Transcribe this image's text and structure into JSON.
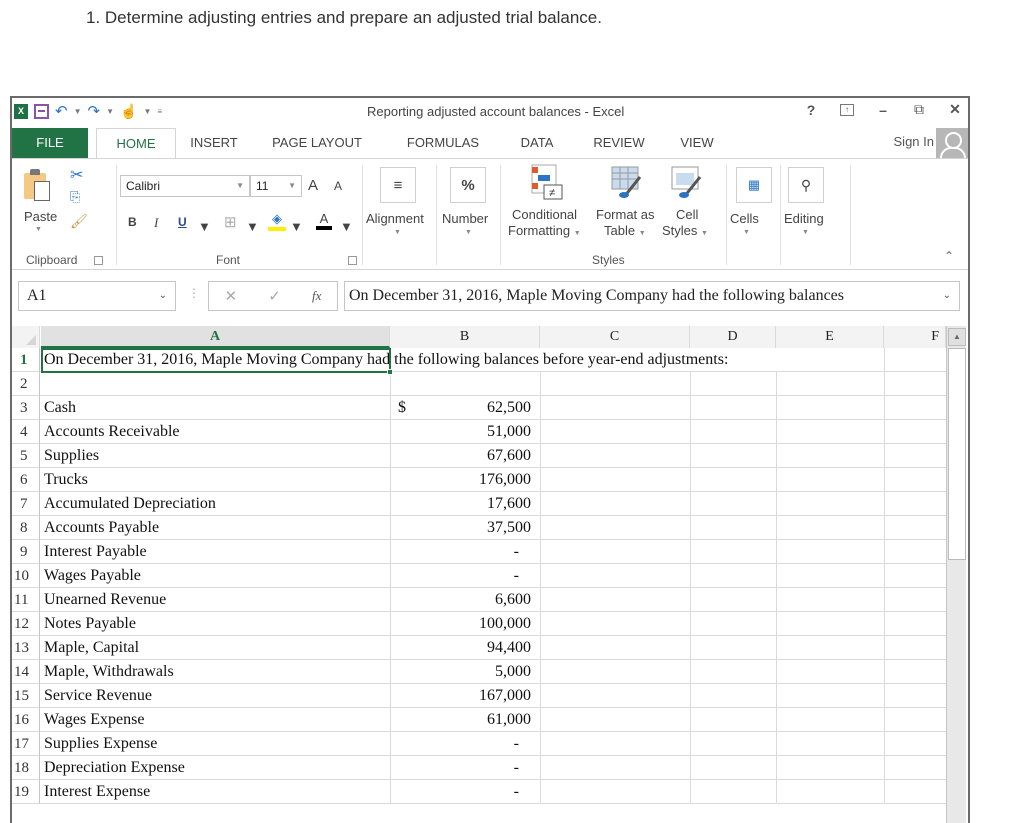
{
  "question": "1.  Determine adjusting entries and prepare an adjusted trial balance.",
  "window": {
    "title": "Reporting adjusted account balances - Excel",
    "controls": {
      "help": "?",
      "minimize": "–",
      "restore": "🗗",
      "close": "✕"
    }
  },
  "tabs": [
    {
      "label": "FILE"
    },
    {
      "label": "HOME"
    },
    {
      "label": "INSERT"
    },
    {
      "label": "PAGE LAYOUT"
    },
    {
      "label": "FORMULAS"
    },
    {
      "label": "DATA"
    },
    {
      "label": "REVIEW"
    },
    {
      "label": "VIEW"
    }
  ],
  "sign_in": "Sign In",
  "ribbon": {
    "clipboard": {
      "label": "Clipboard",
      "paste": "Paste"
    },
    "font": {
      "label": "Font",
      "name": "Calibri",
      "size": "11",
      "bold": "B",
      "italic": "I",
      "underline": "U",
      "grow": "A",
      "shrink": "A",
      "color": "A"
    },
    "alignment": "Alignment",
    "number": "Number",
    "styles": {
      "label": "Styles",
      "conditional_1": "Conditional",
      "conditional_2": "Formatting",
      "format_table_1": "Format as",
      "format_table_2": "Table",
      "cell_styles_1": "Cell",
      "cell_styles_2": "Styles"
    },
    "cells": "Cells",
    "editing": "Editing"
  },
  "formula_bar": {
    "name_box": "A1",
    "fx": "fx",
    "value": "On December 31, 2016, Maple Moving Company had the following balances"
  },
  "columns": [
    "A",
    "B",
    "C",
    "D",
    "E",
    "F"
  ],
  "selected_cell": "A1",
  "rows": [
    {
      "num": "1",
      "a": "On December 31, 2016, Maple Moving Company had the following balances before year-end adjustments:",
      "currency": "",
      "b": ""
    },
    {
      "num": "2",
      "a": "",
      "currency": "",
      "b": ""
    },
    {
      "num": "3",
      "a": "Cash",
      "currency": "$",
      "b": "62,500"
    },
    {
      "num": "4",
      "a": "Accounts Receivable",
      "currency": "",
      "b": "51,000"
    },
    {
      "num": "5",
      "a": "Supplies",
      "currency": "",
      "b": "67,600"
    },
    {
      "num": "6",
      "a": "Trucks",
      "currency": "",
      "b": "176,000"
    },
    {
      "num": "7",
      "a": "Accumulated Depreciation",
      "currency": "",
      "b": "17,600"
    },
    {
      "num": "8",
      "a": "Accounts Payable",
      "currency": "",
      "b": "37,500"
    },
    {
      "num": "9",
      "a": "Interest Payable",
      "currency": "",
      "b": "-"
    },
    {
      "num": "10",
      "a": "Wages Payable",
      "currency": "",
      "b": "-"
    },
    {
      "num": "11",
      "a": "Unearned Revenue",
      "currency": "",
      "b": "6,600"
    },
    {
      "num": "12",
      "a": "Notes Payable",
      "currency": "",
      "b": "100,000"
    },
    {
      "num": "13",
      "a": "Maple, Capital",
      "currency": "",
      "b": "94,400"
    },
    {
      "num": "14",
      "a": "Maple, Withdrawals",
      "currency": "",
      "b": "5,000"
    },
    {
      "num": "15",
      "a": "Service Revenue",
      "currency": "",
      "b": "167,000"
    },
    {
      "num": "16",
      "a": "Wages Expense",
      "currency": "",
      "b": "61,000"
    },
    {
      "num": "17",
      "a": "Supplies Expense",
      "currency": "",
      "b": "-"
    },
    {
      "num": "18",
      "a": "Depreciation Expense",
      "currency": "",
      "b": "-"
    },
    {
      "num": "19",
      "a": "Interest Expense",
      "currency": "",
      "b": "-"
    }
  ],
  "colors": {
    "accent": "#217346",
    "grid": "#dadada"
  }
}
